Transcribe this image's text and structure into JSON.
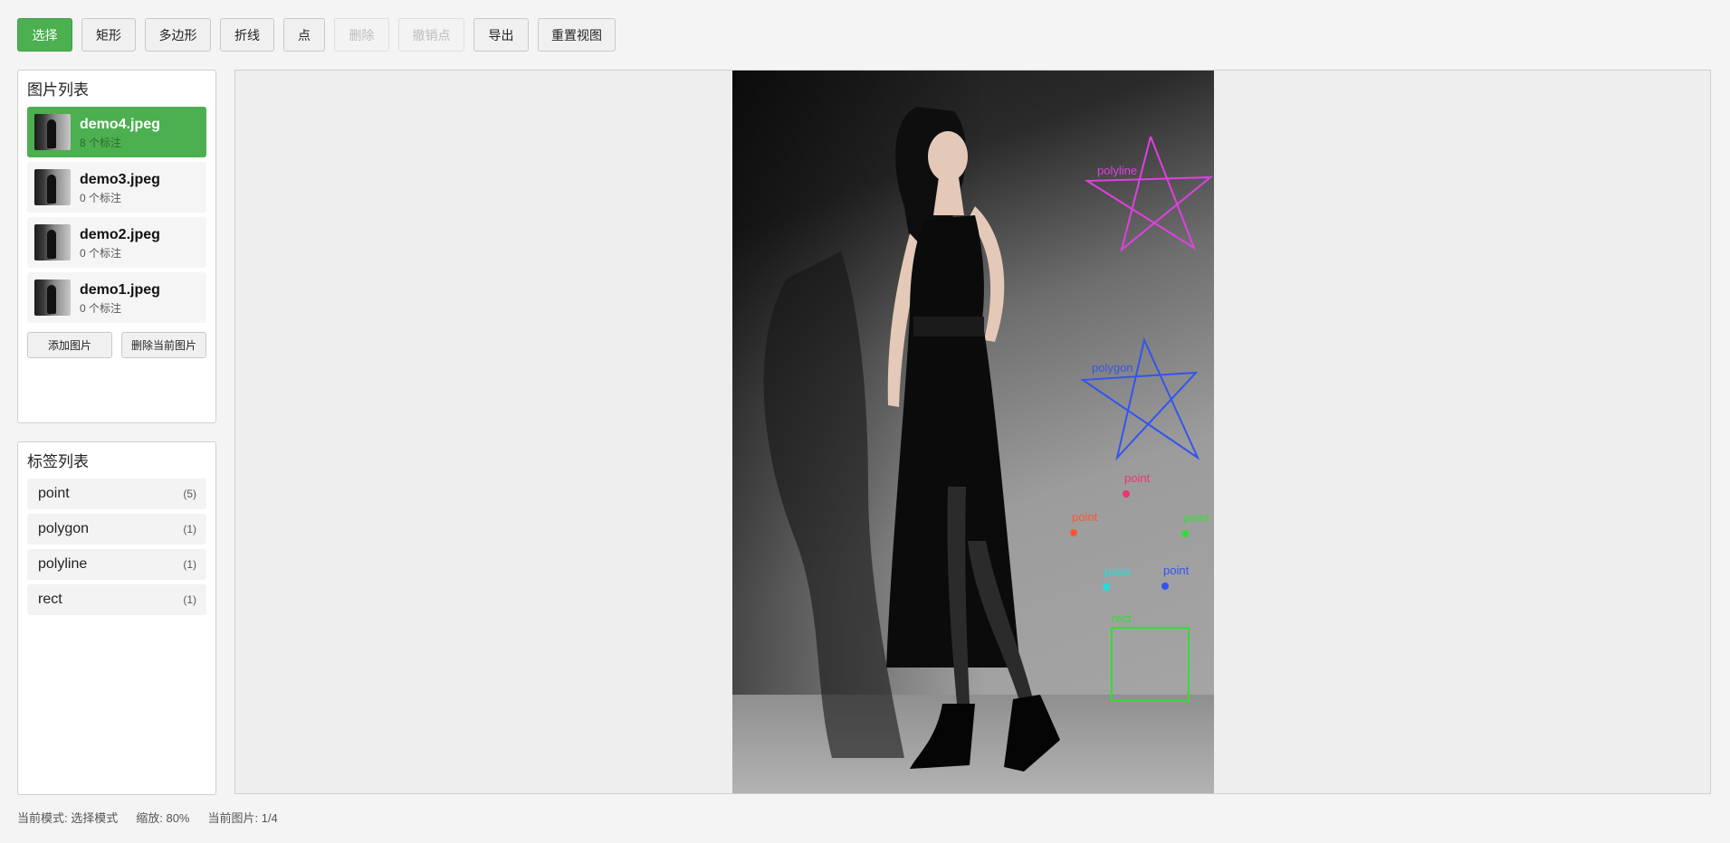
{
  "toolbar": {
    "select": "选择",
    "rect": "矩形",
    "polygon": "多边形",
    "polyline": "折线",
    "point": "点",
    "delete": "删除",
    "undo_point": "撤销点",
    "export": "导出",
    "reset_view": "重置视图"
  },
  "images_panel": {
    "title": "图片列表",
    "items": [
      {
        "name": "demo4.jpeg",
        "count": "8 个标注",
        "selected": true
      },
      {
        "name": "demo3.jpeg",
        "count": "0 个标注",
        "selected": false
      },
      {
        "name": "demo2.jpeg",
        "count": "0 个标注",
        "selected": false
      },
      {
        "name": "demo1.jpeg",
        "count": "0 个标注",
        "selected": false
      }
    ],
    "add_button": "添加图片",
    "delete_button": "删除当前图片"
  },
  "labels_panel": {
    "title": "标签列表",
    "items": [
      {
        "name": "point",
        "count": "(5)"
      },
      {
        "name": "polygon",
        "count": "(1)"
      },
      {
        "name": "polyline",
        "count": "(1)"
      },
      {
        "name": "rect",
        "count": "(1)"
      }
    ]
  },
  "annotations": {
    "polyline": {
      "label": "polyline",
      "color": "#e040e0"
    },
    "polygon": {
      "label": "polygon",
      "color": "#3355ee"
    },
    "rect": {
      "label": "rect",
      "color": "#33dd33"
    },
    "points": [
      {
        "label": "point",
        "color": "#ee3377"
      },
      {
        "label": "point",
        "color": "#ff5533"
      },
      {
        "label": "point",
        "color": "#33dd33"
      },
      {
        "label": "point",
        "color": "#22dddd"
      },
      {
        "label": "point",
        "color": "#3355ee"
      }
    ]
  },
  "status": {
    "mode": "当前模式: 选择模式",
    "zoom": "缩放: 80%",
    "image": "当前图片: 1/4"
  },
  "colors": {
    "accent": "#4caf50"
  }
}
